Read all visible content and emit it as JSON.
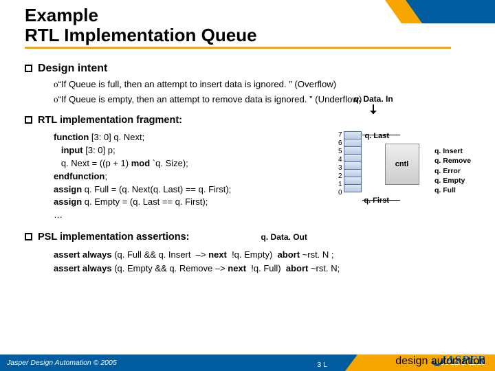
{
  "title": {
    "line1": "Example",
    "line2": "RTL Implementation Queue"
  },
  "sections": {
    "design_intent": {
      "heading": "Design intent",
      "items": [
        "“If Queue is full, then an attempt to insert data is ignored. ” (Overflow)",
        "“If Queue is empty, then an attempt to remove data is ignored. ” (Underflow)"
      ]
    },
    "rtl_fragment": {
      "heading": "RTL implementation fragment:",
      "code": [
        {
          "t": "kw",
          "v": "function"
        },
        {
          "t": "",
          "v": " [3: 0] q. Next;"
        },
        {
          "t": "br"
        },
        {
          "t": "sp",
          "v": "   "
        },
        {
          "t": "kw",
          "v": "input"
        },
        {
          "t": "",
          "v": " [3: 0] p;"
        },
        {
          "t": "br"
        },
        {
          "t": "sp",
          "v": "   "
        },
        {
          "t": "",
          "v": "q. Next = ((p + 1) "
        },
        {
          "t": "kw",
          "v": "mod"
        },
        {
          "t": "",
          "v": " `q. Size);"
        },
        {
          "t": "br"
        },
        {
          "t": "kw",
          "v": "endfunction"
        },
        {
          "t": "",
          "v": ";"
        },
        {
          "t": "br"
        },
        {
          "t": "kw",
          "v": "assign"
        },
        {
          "t": "",
          "v": " q. Full = (q. Next(q. Last) == q. First);"
        },
        {
          "t": "br"
        },
        {
          "t": "kw",
          "v": "assign"
        },
        {
          "t": "",
          "v": " q. Empty = (q. Last == q. First);"
        },
        {
          "t": "br"
        },
        {
          "t": "",
          "v": "…"
        }
      ]
    },
    "psl_assertions": {
      "heading": "PSL implementation assertions:",
      "lines": [
        "assert always (q. Full && q. Insert  –> next  !q. Empty)  abort ~rst. N ;",
        "assert always (q. Empty && q. Remove –> next  !q. Full)  abort ~rst. N;"
      ]
    }
  },
  "diagram": {
    "data_in": "q. Data. In",
    "data_out": "q. Data. Out",
    "qlast": "q. Last",
    "qfirst": "q. First",
    "cntl": "cntl",
    "indices": [
      "7",
      "6",
      "5",
      "4",
      "3",
      "2",
      "1",
      "0"
    ],
    "signals": [
      "q. Insert",
      "q. Remove",
      "q. Error",
      "q. Empty",
      "q. Full"
    ]
  },
  "footer": {
    "copyright": "Jasper Design Automation © 2005",
    "page": "3 L",
    "brand": "JASPER",
    "brand_sub": "design automation"
  }
}
